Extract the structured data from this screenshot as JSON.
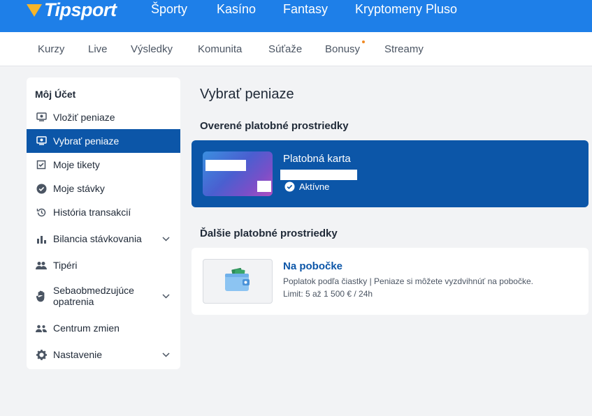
{
  "header": {
    "logo_text": "Tipsport",
    "nav": [
      "Športy",
      "Kasíno",
      "Fantasy",
      "Kryptomeny Pluso"
    ]
  },
  "subnav": {
    "items": [
      "Kurzy",
      "Live",
      "Výsledky",
      "Komunita",
      "Súťaže",
      "Bonusy",
      "Streamy"
    ]
  },
  "sidebar": {
    "heading": "Môj Účet",
    "items": [
      {
        "label": "Vložiť peniaze",
        "icon": "deposit-icon"
      },
      {
        "label": "Vybrať peniaze",
        "icon": "withdraw-icon",
        "active": true
      },
      {
        "label": "Moje tikety",
        "icon": "tickets-icon"
      },
      {
        "label": "Moje stávky",
        "icon": "check-circle-icon"
      },
      {
        "label": "História transakcií",
        "icon": "history-icon"
      },
      {
        "label": "Bilancia stávkovania",
        "icon": "bar-chart-icon",
        "expandable": true
      },
      {
        "label": "Tipéri",
        "icon": "people-icon"
      },
      {
        "label": "Sebaobmedzujúce opatrenia",
        "icon": "hand-icon",
        "expandable": true
      },
      {
        "label": "Centrum zmien",
        "icon": "people-swap-icon"
      },
      {
        "label": "Nastavenie",
        "icon": "gear-icon",
        "expandable": true
      }
    ]
  },
  "main": {
    "title": "Vybrať peniaze",
    "verified_title": "Overené platobné prostriedky",
    "card": {
      "name": "Platobná karta",
      "status": "Aktívne"
    },
    "other_title": "Ďalšie platobné prostriedky",
    "branch": {
      "name": "Na pobočke",
      "description": "Poplatok podľa čiastky  |  Peniaze si môžete vyzdvihnúť na pobočke.",
      "limit": "Limit: 5 až 1 500 € / 24h"
    }
  },
  "colors": {
    "brand_blue": "#1e7fe8",
    "active_blue": "#0c56a8",
    "logo_orange": "#f6b52a",
    "badge_dot": "#f08a24"
  }
}
